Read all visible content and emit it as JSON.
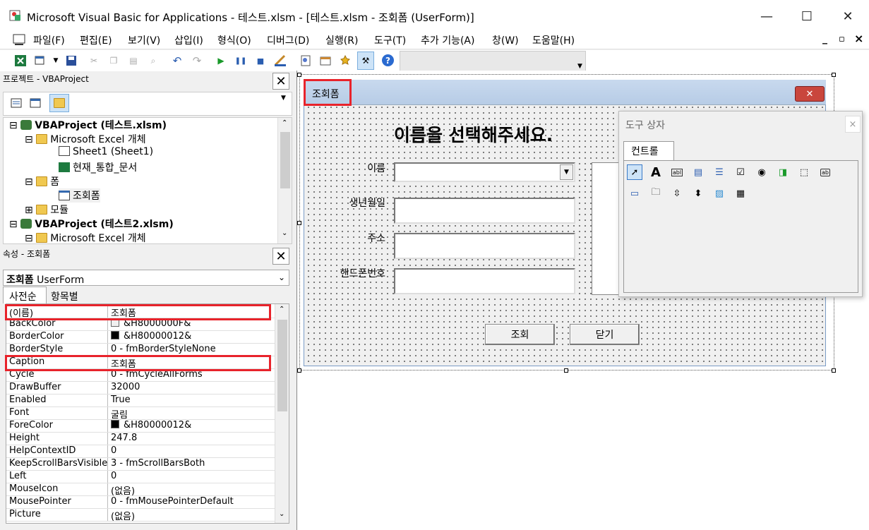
{
  "window": {
    "title": "Microsoft Visual Basic for Applications - 테스트.xlsm - [테스트.xlsm - 조회폼 (UserForm)]",
    "minimize": "—",
    "maximize": "☐",
    "close": "✕"
  },
  "menu": {
    "items": [
      "파일(F)",
      "편집(E)",
      "보기(V)",
      "삽입(I)",
      "형식(O)",
      "디버그(D)",
      "실행(R)",
      "도구(T)",
      "추가 기능(A)",
      "창(W)",
      "도움말(H)"
    ],
    "mdi_min": "_",
    "mdi_restore": "▫",
    "mdi_close": "×"
  },
  "project": {
    "title": "프로젝트 - VBAProject",
    "tree": [
      {
        "label": "VBAProject (테스트.xlsm)",
        "level": 0,
        "bold": true,
        "toggle": "⊟"
      },
      {
        "label": "Microsoft Excel 개체",
        "level": 1,
        "toggle": "⊟"
      },
      {
        "label": "Sheet1 (Sheet1)",
        "level": 2
      },
      {
        "label": "현재_통합_문서",
        "level": 2
      },
      {
        "label": "폼",
        "level": 1,
        "toggle": "⊟"
      },
      {
        "label": "조회폼",
        "level": 2
      },
      {
        "label": "모듈",
        "level": 1,
        "toggle": "⊞"
      },
      {
        "label": "VBAProject (테스트2.xlsm)",
        "level": 0,
        "bold": true,
        "toggle": "⊟"
      },
      {
        "label": "Microsoft Excel 개체",
        "level": 1,
        "toggle": "⊟"
      }
    ]
  },
  "properties": {
    "title": "속성 - 조회폼",
    "object_name": "조회폼",
    "object_type": "UserForm",
    "tab_alpha": "사전순",
    "tab_category": "항목별",
    "rows": [
      {
        "name": "(이름)",
        "value": "조회폼"
      },
      {
        "name": "BackColor",
        "value": "&H8000000F&",
        "swatch": "#f0f0f0"
      },
      {
        "name": "BorderColor",
        "value": "&H80000012&",
        "swatch": "#000000"
      },
      {
        "name": "BorderStyle",
        "value": "0 - fmBorderStyleNone"
      },
      {
        "name": "Caption",
        "value": "조회폼"
      },
      {
        "name": "Cycle",
        "value": "0 - fmCycleAllForms"
      },
      {
        "name": "DrawBuffer",
        "value": "32000"
      },
      {
        "name": "Enabled",
        "value": "True"
      },
      {
        "name": "Font",
        "value": "굴림"
      },
      {
        "name": "ForeColor",
        "value": "&H80000012&",
        "swatch": "#000000"
      },
      {
        "name": "Height",
        "value": "247.8"
      },
      {
        "name": "HelpContextID",
        "value": "0"
      },
      {
        "name": "KeepScrollBarsVisible",
        "value": "3 - fmScrollBarsBoth"
      },
      {
        "name": "Left",
        "value": "0"
      },
      {
        "name": "MouseIcon",
        "value": "(없음)"
      },
      {
        "name": "MousePointer",
        "value": "0 - fmMousePointerDefault"
      },
      {
        "name": "Picture",
        "value": "(없음)"
      }
    ]
  },
  "form": {
    "caption": "조회폼",
    "heading": "이름을 선택해주세요.",
    "label_name": "이름",
    "label_birth": "생년월일",
    "label_address": "주소",
    "label_phone": "핸드폰번호",
    "btn_search": "조회",
    "btn_close": "닫기",
    "close_x": "✕"
  },
  "toolbox": {
    "title": "도구 상자",
    "tab": "컨트롤",
    "close": "×"
  },
  "colors": {
    "highlight": "#e8232b",
    "form_title": "#c8d9ee",
    "close_red": "#c9463d"
  }
}
